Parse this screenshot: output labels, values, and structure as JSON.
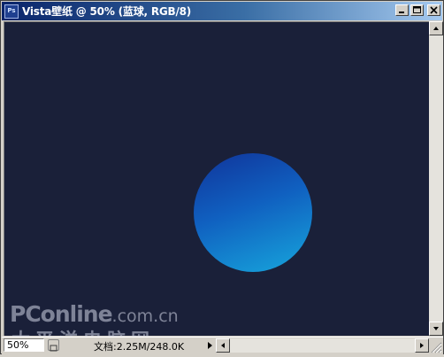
{
  "window": {
    "title": "Vista壁纸 @ 50% (蓝球, RGB/8)",
    "app_icon_text": "Ps"
  },
  "canvas": {
    "background_color": "#1a2039",
    "ball_gradient": [
      "#10349a",
      "#1060c0",
      "#17a6dc"
    ]
  },
  "watermark": {
    "brand": "PConline",
    "domain": ".com.cn",
    "chinese": "太平洋电脑网"
  },
  "statusbar": {
    "zoom": "50%",
    "doc_info": "文档:2.25M/248.0K"
  },
  "icons": {
    "minimize": "minimize-icon",
    "maximize": "maximize-icon",
    "close": "close-icon",
    "scroll_up": "arrow-up-icon",
    "scroll_down": "arrow-down-icon",
    "scroll_left": "arrow-left-icon",
    "scroll_right": "arrow-right-icon",
    "status_menu": "triangle-right-icon"
  }
}
